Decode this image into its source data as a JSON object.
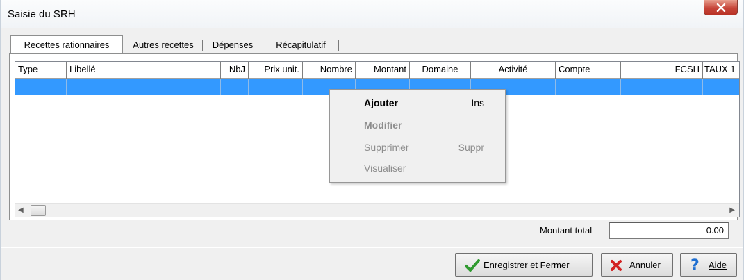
{
  "window": {
    "title": "Saisie du SRH",
    "close_icon": "close-icon"
  },
  "tabs": [
    {
      "label": "Recettes rationnaires",
      "active": true
    },
    {
      "label": "Autres recettes",
      "active": false
    },
    {
      "label": "Dépenses",
      "active": false
    },
    {
      "label": "Récapitulatif",
      "active": false
    }
  ],
  "grid": {
    "columns": [
      "Type",
      "Libellé",
      "NbJ",
      "Prix unit.",
      "Nombre",
      "Montant",
      "Domaine",
      "Activité",
      "Compte",
      "FCSH",
      "TAUX 1"
    ],
    "selected_row_color": "#3399ff"
  },
  "context_menu": {
    "items": [
      {
        "label": "Ajouter",
        "shortcut": "Ins",
        "enabled": true
      },
      {
        "label": "Modifier",
        "shortcut": "",
        "enabled": false
      },
      {
        "label": "Supprimer",
        "shortcut": "Suppr",
        "enabled": false
      },
      {
        "label": "Visualiser",
        "shortcut": "",
        "enabled": false
      }
    ]
  },
  "total": {
    "label": "Montant total",
    "value": "0.00"
  },
  "buttons": {
    "save_label": "Enregistrer et Fermer",
    "cancel_label": "Annuler",
    "help_label": "Aide",
    "save_icon": "checkmark-icon",
    "cancel_icon": "red-x-icon",
    "help_icon": "question-mark-icon"
  }
}
